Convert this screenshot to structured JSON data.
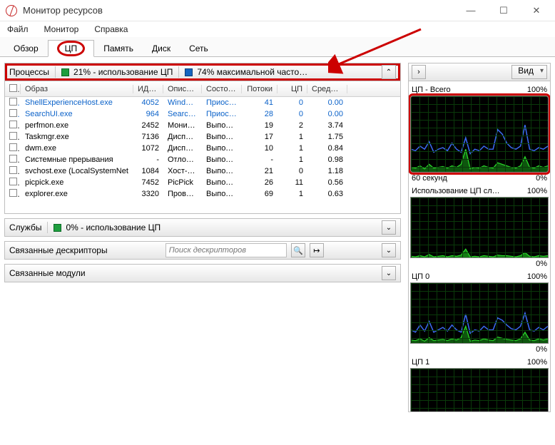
{
  "window": {
    "title": "Монитор ресурсов"
  },
  "menu": [
    "Файл",
    "Монитор",
    "Справка"
  ],
  "tabs": [
    "Обзор",
    "ЦП",
    "Память",
    "Диск",
    "Сеть"
  ],
  "active_tab": "ЦП",
  "panels": {
    "processes": {
      "title": "Процессы",
      "cpu_usage_label": "21% - использование ЦП",
      "max_freq_label": "74% максимальной часто…",
      "columns": {
        "image": "Образ",
        "pid": "ИД п…",
        "desc": "Описа…",
        "status": "Состоя…",
        "threads": "Потоки",
        "cpu": "ЦП",
        "avg": "Средн…"
      }
    },
    "services": {
      "title": "Службы",
      "cpu_usage_label": "0% - использование ЦП"
    },
    "handles": {
      "title": "Связанные дескрипторы",
      "search_placeholder": "Поиск дескрипторов"
    },
    "modules": {
      "title": "Связанные модули"
    }
  },
  "processes_rows": [
    {
      "image": "ShellExperienceHost.exe",
      "pid": "4052",
      "desc": "Windo…",
      "status": "Приос…",
      "threads": "41",
      "cpu": "0",
      "avg": "0.00",
      "highlighted": true
    },
    {
      "image": "SearchUI.exe",
      "pid": "964",
      "desc": "Search …",
      "status": "Приос…",
      "threads": "28",
      "cpu": "0",
      "avg": "0.00",
      "highlighted": true
    },
    {
      "image": "perfmon.exe",
      "pid": "2452",
      "desc": "Монит…",
      "status": "Выпол…",
      "threads": "19",
      "cpu": "2",
      "avg": "3.74",
      "highlighted": false
    },
    {
      "image": "Taskmgr.exe",
      "pid": "7136",
      "desc": "Диспе…",
      "status": "Выпол…",
      "threads": "17",
      "cpu": "1",
      "avg": "1.75",
      "highlighted": false
    },
    {
      "image": "dwm.exe",
      "pid": "1072",
      "desc": "Диспе…",
      "status": "Выпол…",
      "threads": "10",
      "cpu": "1",
      "avg": "0.84",
      "highlighted": false
    },
    {
      "image": "Системные прерывания",
      "pid": "-",
      "desc": "Отлож…",
      "status": "Выпол…",
      "threads": "-",
      "cpu": "1",
      "avg": "0.98",
      "highlighted": false
    },
    {
      "image": "svchost.exe (LocalSystemNet",
      "pid": "1084",
      "desc": "Хост-п…",
      "status": "Выпол…",
      "threads": "21",
      "cpu": "0",
      "avg": "1.18",
      "highlighted": false
    },
    {
      "image": "picpick.exe",
      "pid": "7452",
      "desc": "PicPick",
      "status": "Выпол…",
      "threads": "26",
      "cpu": "11",
      "avg": "0.56",
      "highlighted": false
    },
    {
      "image": "explorer.exe",
      "pid": "3320",
      "desc": "Прово…",
      "status": "Выпол…",
      "threads": "69",
      "cpu": "1",
      "avg": "0.63",
      "highlighted": false
    }
  ],
  "right": {
    "view_label": "Вид",
    "graphs": [
      {
        "title": "ЦП - Всего",
        "right_top": "100%",
        "bottom_left": "60 секунд",
        "bottom_right": "0%",
        "highlighted": true,
        "tall": true
      },
      {
        "title": "Использование ЦП сл…",
        "right_top": "100%",
        "bottom_left": "",
        "bottom_right": "0%",
        "highlighted": false,
        "tall": false
      },
      {
        "title": "ЦП 0",
        "right_top": "100%",
        "bottom_left": "",
        "bottom_right": "0%",
        "highlighted": false,
        "tall": false
      },
      {
        "title": "ЦП 1",
        "right_top": "100%",
        "bottom_left": "",
        "bottom_right": "",
        "highlighted": false,
        "tall": false
      }
    ]
  },
  "chart_data": [
    {
      "type": "line",
      "title": "ЦП - Всего",
      "ylim": [
        0,
        100
      ],
      "xlabel": "60 секунд",
      "series": [
        {
          "name": "total",
          "color": "#3b6af1",
          "values": [
            30,
            28,
            34,
            30,
            40,
            26,
            30,
            32,
            28,
            38,
            30,
            26,
            45,
            24,
            30,
            28,
            34,
            30,
            30,
            56,
            50,
            38,
            32,
            30,
            34,
            62,
            30,
            28,
            32,
            30,
            34
          ]
        },
        {
          "name": "kernel",
          "color": "#29d629",
          "values": [
            6,
            5,
            8,
            4,
            10,
            5,
            6,
            7,
            5,
            8,
            6,
            10,
            30,
            4,
            6,
            5,
            8,
            6,
            5,
            12,
            10,
            8,
            6,
            5,
            8,
            20,
            6,
            5,
            8,
            6,
            8
          ]
        }
      ]
    },
    {
      "type": "area",
      "title": "Использование ЦП сл…",
      "ylim": [
        0,
        100
      ],
      "series": [
        {
          "name": "services",
          "color": "#29d629",
          "values": [
            2,
            1,
            3,
            1,
            5,
            1,
            2,
            3,
            1,
            3,
            2,
            4,
            14,
            1,
            2,
            1,
            3,
            2,
            1,
            4,
            3,
            3,
            2,
            1,
            3,
            8,
            2,
            1,
            3,
            2,
            3
          ]
        }
      ]
    },
    {
      "type": "line",
      "title": "ЦП 0",
      "ylim": [
        0,
        100
      ],
      "series": [
        {
          "name": "total",
          "color": "#3b6af1",
          "values": [
            22,
            18,
            30,
            20,
            36,
            18,
            22,
            26,
            20,
            30,
            22,
            18,
            48,
            16,
            22,
            20,
            28,
            22,
            22,
            42,
            38,
            30,
            24,
            22,
            28,
            50,
            22,
            20,
            26,
            22,
            28
          ]
        },
        {
          "name": "kernel",
          "color": "#29d629",
          "values": [
            5,
            4,
            7,
            3,
            9,
            4,
            5,
            6,
            4,
            7,
            5,
            9,
            28,
            3,
            5,
            4,
            7,
            5,
            4,
            10,
            8,
            6,
            5,
            4,
            7,
            18,
            5,
            4,
            7,
            5,
            7
          ]
        }
      ]
    },
    {
      "type": "line",
      "title": "ЦП 1",
      "ylim": [
        0,
        100
      ],
      "series": []
    }
  ]
}
